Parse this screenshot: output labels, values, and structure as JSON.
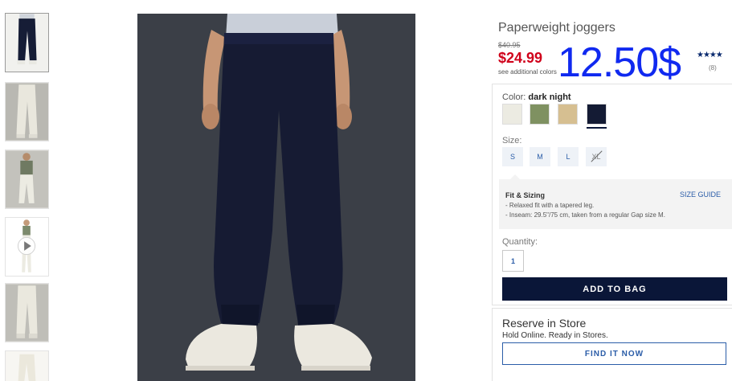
{
  "product": {
    "title": "Paperweight joggers",
    "original_price": "$40.95",
    "sale_price": "$24.99",
    "see_colors_link": "see additional colors",
    "overlay_price": "12.50$",
    "rating_stars": "★★★★",
    "review_count": "(8)"
  },
  "color": {
    "label": "Color:",
    "selected_name": "dark night",
    "swatches": [
      {
        "name": "cream",
        "hex": "#ecebe2"
      },
      {
        "name": "olive",
        "hex": "#7f9161"
      },
      {
        "name": "khaki",
        "hex": "#d6bf91"
      },
      {
        "name": "dark night",
        "hex": "#141b34"
      }
    ]
  },
  "size": {
    "label": "Size:",
    "options": [
      "S",
      "M",
      "L",
      "XL"
    ],
    "unavailable": [
      "XL"
    ]
  },
  "fit": {
    "title": "Fit & Sizing",
    "size_guide_link": "SIZE GUIDE",
    "lines": [
      "- Relaxed fit with a tapered leg.",
      "- Inseam: 29.5\"/75 cm, taken from a regular Gap size M."
    ]
  },
  "quantity": {
    "label": "Quantity:",
    "value": "1"
  },
  "actions": {
    "add_to_bag": "ADD TO BAG"
  },
  "reserve": {
    "title": "Reserve in Store",
    "subtitle": "Hold Online. Ready in Stores.",
    "find_button": "FIND IT NOW"
  },
  "thumbnails": [
    {
      "name": "navy-front",
      "icon": "pants-photo"
    },
    {
      "name": "cream-front",
      "icon": "pants-photo"
    },
    {
      "name": "cream-full-body",
      "icon": "model-photo"
    },
    {
      "name": "video",
      "icon": "play-icon"
    },
    {
      "name": "cream-back",
      "icon": "pants-photo"
    },
    {
      "name": "cream-flat",
      "icon": "pants-photo"
    }
  ],
  "colors": {
    "sale_red": "#d0021b",
    "navy": "#0a1638",
    "link_blue": "#2b5da8",
    "overlay_blue": "#1029f0"
  }
}
